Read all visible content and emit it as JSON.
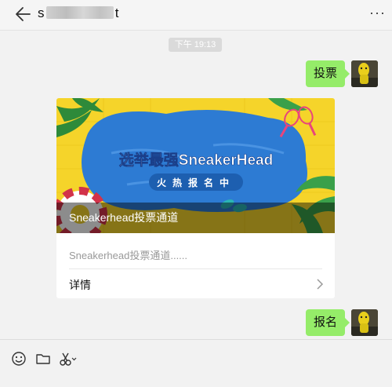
{
  "header": {
    "title_prefix": "s",
    "title_suffix": "t",
    "more_label": "···"
  },
  "chat": {
    "timestamp": "下午 19:13",
    "messages": [
      {
        "type": "text",
        "text": "投票"
      },
      {
        "type": "link_card",
        "banner_headline": "选举最强SneakerHead",
        "banner_tagline": "火热报名中",
        "banner_caption": "Sneakerhead投票通道",
        "description": "Sneakerhead投票通道......",
        "detail_label": "详情"
      },
      {
        "type": "text",
        "text": "报名"
      }
    ]
  },
  "colors": {
    "bubble_green": "#95ec69",
    "banner_blue": "#2d7bd3",
    "banner_yellow": "#f5d42a"
  },
  "toolbar": {
    "icons": [
      "emoji-icon",
      "folder-icon",
      "scissors-icon"
    ]
  }
}
